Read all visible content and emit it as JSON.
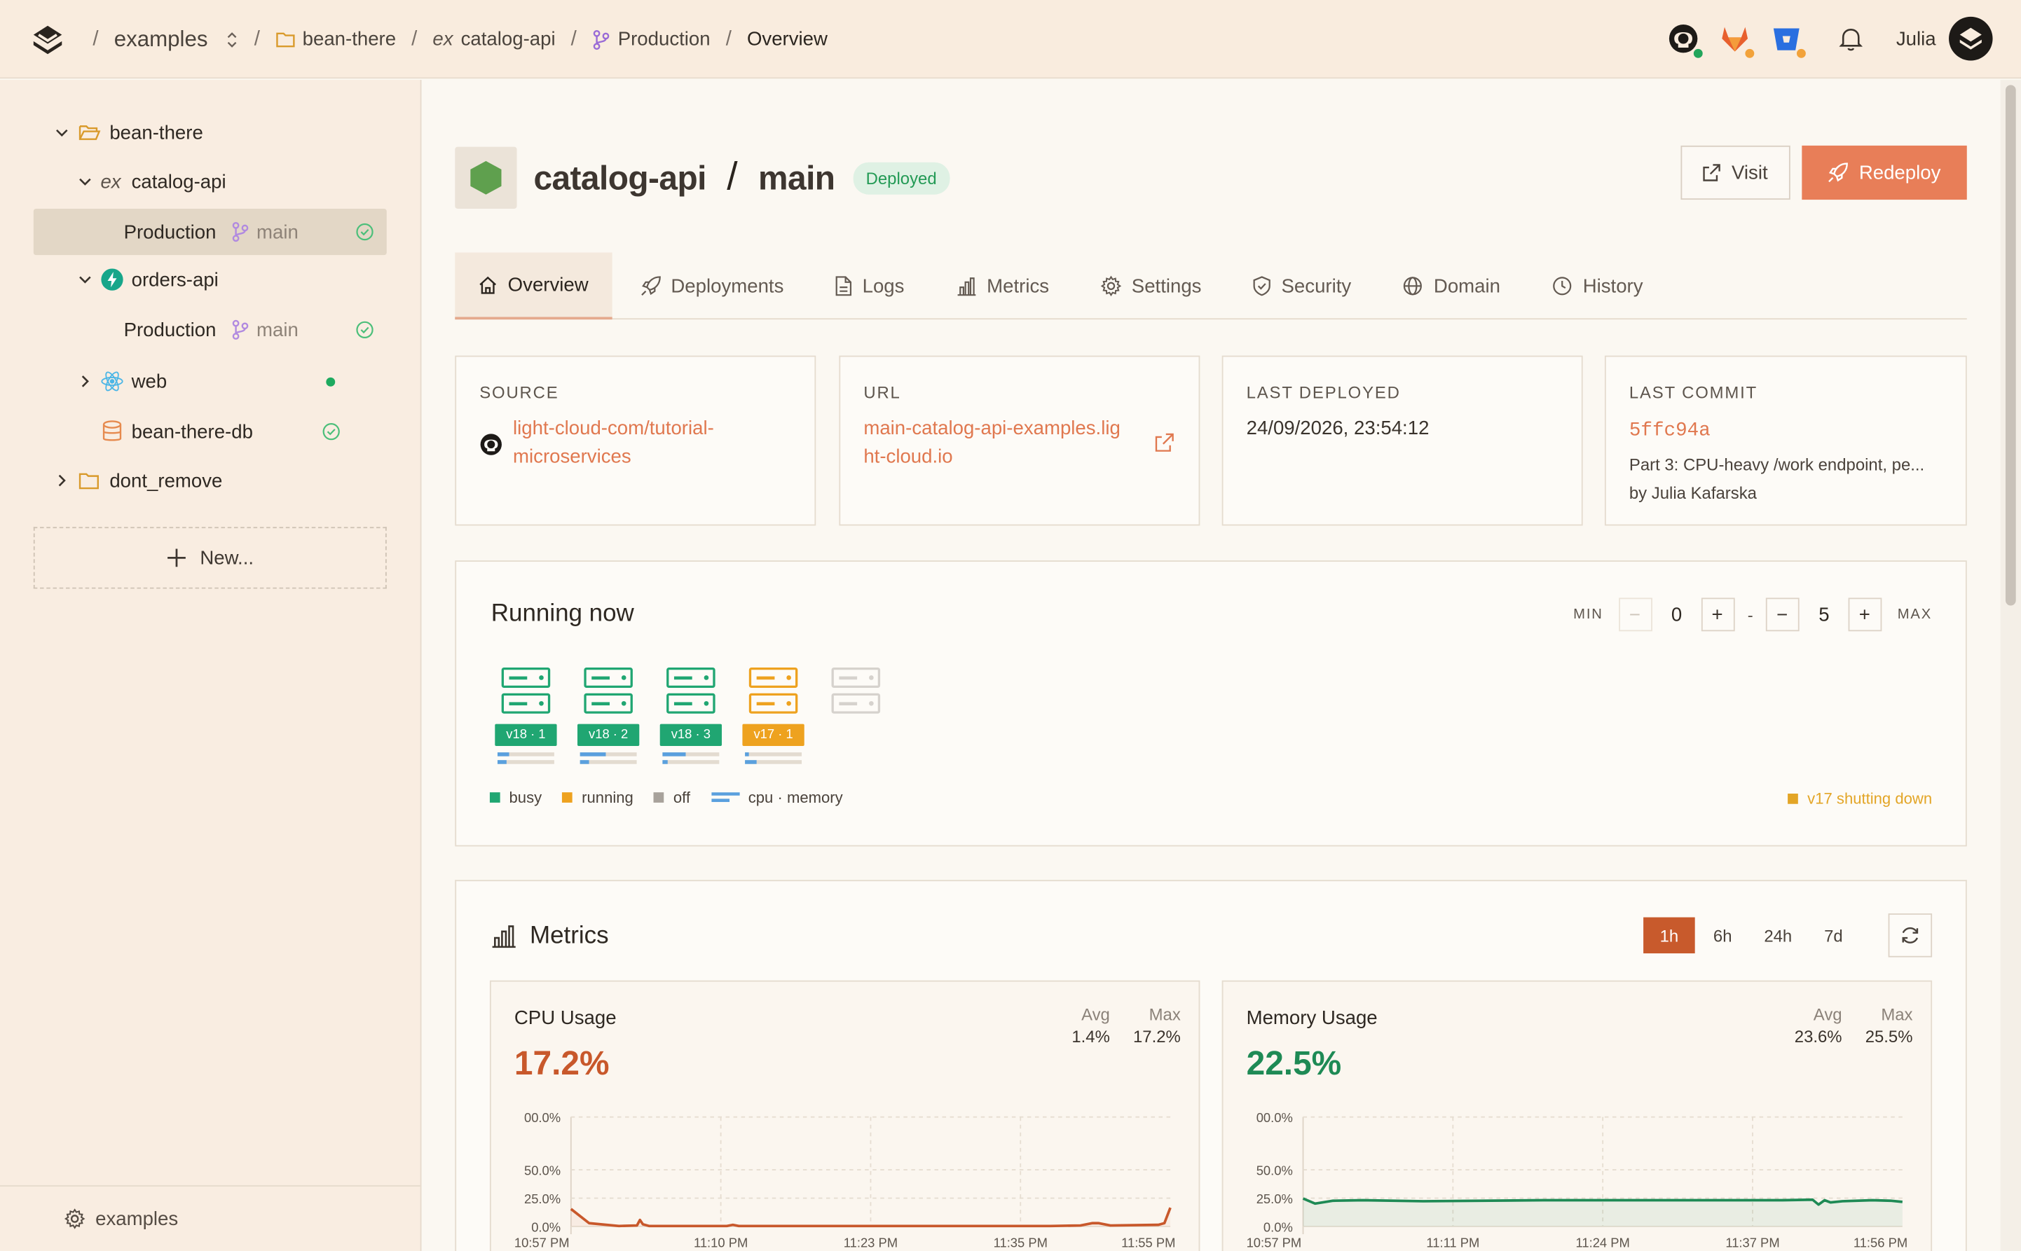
{
  "breadcrumb": {
    "org": "examples",
    "project": "bean-there",
    "service_prefix": "ex",
    "service": "catalog-api",
    "environment": "Production",
    "page": "Overview"
  },
  "topbar": {
    "user": "Julia",
    "integrations": [
      {
        "name": "github-icon",
        "status_color": "#22a55b"
      },
      {
        "name": "gitlab-icon",
        "status_color": "#f2a23a"
      },
      {
        "name": "bitbucket-icon",
        "status_color": "#f2a23a"
      }
    ]
  },
  "sidebar": {
    "project": "bean-there",
    "catalog_prefix": "ex",
    "catalog": "catalog-api",
    "catalog_env": "Production",
    "catalog_branch": "main",
    "orders": "orders-api",
    "orders_env": "Production",
    "orders_branch": "main",
    "web": "web",
    "db": "bean-there-db",
    "other_project": "dont_remove",
    "new_label": "New...",
    "footer": "examples"
  },
  "header": {
    "service": "catalog-api",
    "separator": "/",
    "branch": "main",
    "status": "Deployed",
    "visit_label": "Visit",
    "redeploy_label": "Redeploy"
  },
  "tabs": [
    "Overview",
    "Deployments",
    "Logs",
    "Metrics",
    "Settings",
    "Security",
    "Domain",
    "History"
  ],
  "info": {
    "source_label": "SOURCE",
    "source_line1": "light-cloud-com/tutorial-",
    "source_line2": "microservices",
    "url_label": "URL",
    "url_line1": "main-catalog-api-examples.lig",
    "url_line2": "ht-cloud.io",
    "deployed_label": "LAST DEPLOYED",
    "deployed_value": "24/09/2026, 23:54:12",
    "commit_label": "LAST COMMIT",
    "commit_hash": "5ffc94a",
    "commit_msg": "Part 3: CPU-heavy /work endpoint, pe...",
    "commit_author": "by Julia Kafarska"
  },
  "running": {
    "title": "Running now",
    "min_label": "MIN",
    "min_value": "0",
    "dash": "-",
    "max_value": "5",
    "max_label": "MAX",
    "instances": [
      {
        "label": "v18 · 1",
        "state": "busy",
        "cpu": 0.2,
        "mem": 0.15
      },
      {
        "label": "v18 · 2",
        "state": "busy",
        "cpu": 0.45,
        "mem": 0.15
      },
      {
        "label": "v18 · 3",
        "state": "busy",
        "cpu": 0.4,
        "mem": 0.1
      },
      {
        "label": "v17 · 1",
        "state": "running",
        "cpu": 0.05,
        "mem": 0.2
      },
      {
        "label": "",
        "state": "off",
        "cpu": 0,
        "mem": 0
      }
    ],
    "legend": {
      "busy": "busy",
      "running": "running",
      "off": "off",
      "cpu": "cpu · memory"
    },
    "shutting_down": "v17 shutting down",
    "colors": {
      "busy": "#20a672",
      "running": "#eea21f",
      "off": "#d6d2cd",
      "cpu": "#5aa0de"
    }
  },
  "metrics": {
    "title": "Metrics",
    "ranges": [
      "1h",
      "6h",
      "24h",
      "7d"
    ],
    "active_range": "1h",
    "cpu": {
      "title": "CPU Usage",
      "value": "17.2%",
      "avg_label": "Avg",
      "avg": "1.4%",
      "max_label": "Max",
      "max": "17.2%",
      "color": "#c8582b"
    },
    "memory": {
      "title": "Memory Usage",
      "value": "22.5%",
      "avg_label": "Avg",
      "avg": "23.6%",
      "max_label": "Max",
      "max": "25.5%",
      "color": "#1e8a55"
    }
  },
  "chart_data": [
    {
      "type": "line",
      "title": "CPU Usage",
      "y_ticks": [
        "00.0%",
        "50.0%",
        "25.0%",
        "0.0%"
      ],
      "x_ticks": [
        "10:57 PM",
        "11:10 PM",
        "11:23 PM",
        "11:35 PM",
        "11:55 PM"
      ],
      "ylim": [
        0,
        100
      ],
      "x": [
        0,
        0.03,
        0.08,
        0.11,
        0.115,
        0.12,
        0.13,
        0.2,
        0.26,
        0.27,
        0.28,
        0.3,
        0.5,
        0.8,
        0.85,
        0.87,
        0.88,
        0.9,
        0.98,
        0.99,
        1.0
      ],
      "series": [
        {
          "values": [
            16,
            3,
            0.5,
            1,
            6,
            2,
            0.5,
            0.5,
            0.5,
            1.5,
            0.5,
            0.5,
            0.5,
            0.5,
            1,
            3,
            3,
            1,
            1.5,
            3,
            17.2
          ]
        }
      ]
    },
    {
      "type": "line",
      "title": "Memory Usage",
      "y_ticks": [
        "00.0%",
        "50.0%",
        "25.0%",
        "0.0%"
      ],
      "x_ticks": [
        "10:57 PM",
        "11:11 PM",
        "11:24 PM",
        "11:37 PM",
        "11:56 PM"
      ],
      "ylim": [
        0,
        100
      ],
      "x": [
        0,
        0.02,
        0.05,
        0.1,
        0.2,
        0.4,
        0.6,
        0.8,
        0.85,
        0.86,
        0.87,
        0.88,
        0.9,
        0.95,
        0.98,
        1.0
      ],
      "series": [
        {
          "values": [
            25.5,
            21,
            23.5,
            24,
            23,
            24,
            24,
            24,
            24.5,
            20,
            24,
            22,
            23,
            24,
            23.5,
            22.5
          ]
        }
      ]
    }
  ]
}
